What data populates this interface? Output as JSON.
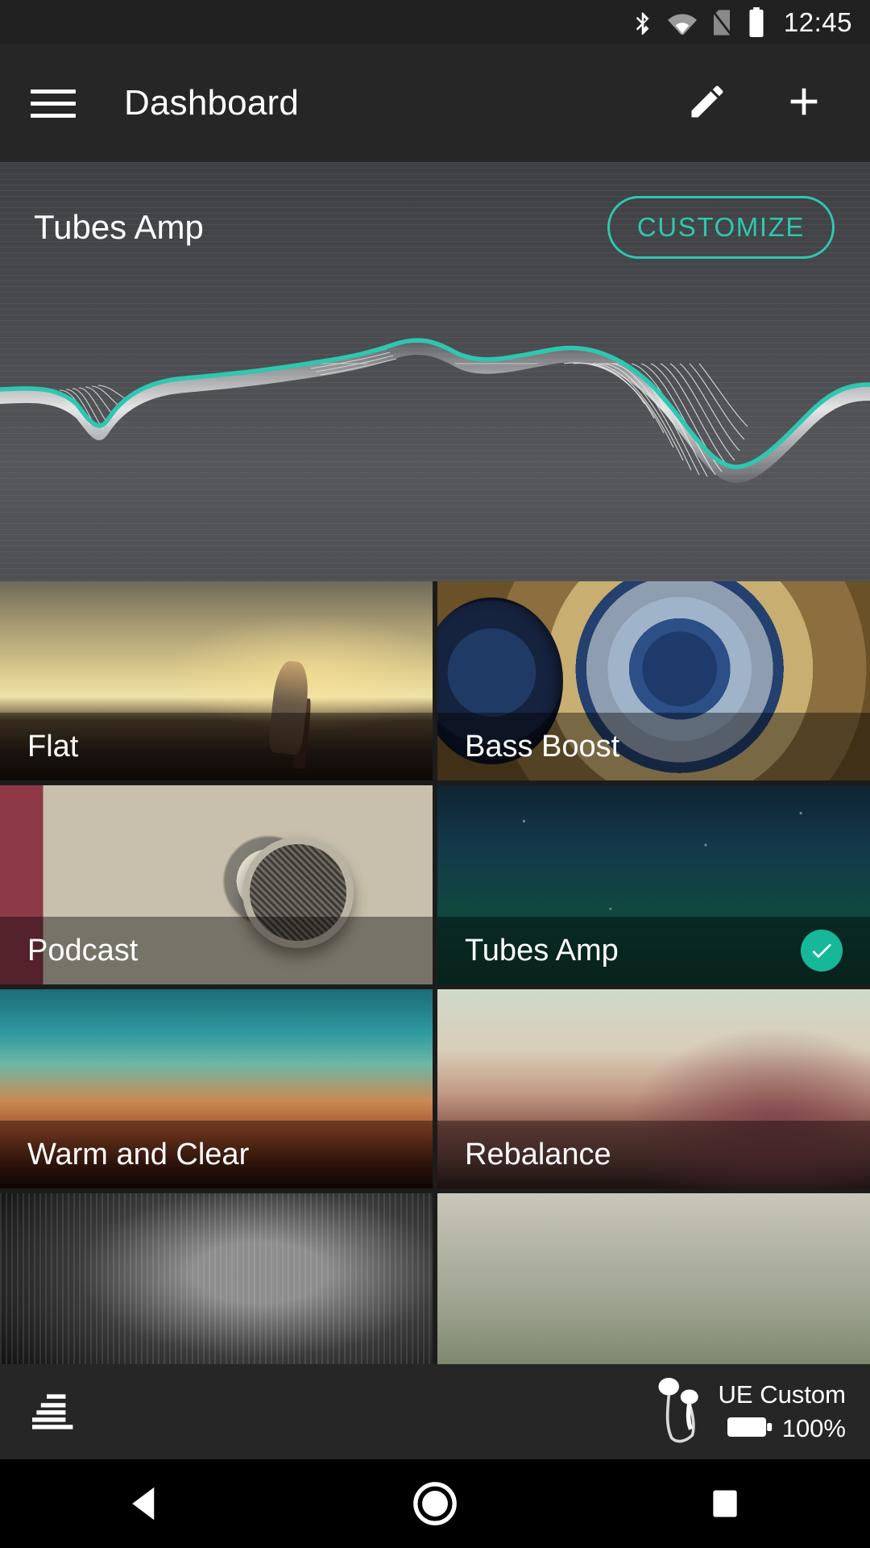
{
  "statusbar": {
    "clock": "12:45",
    "icons": [
      "bluetooth-icon",
      "wifi-icon",
      "sim-card-off-icon",
      "battery-icon"
    ]
  },
  "appbar": {
    "menu_icon": "hamburger-menu-icon",
    "title": "Dashboard",
    "edit_icon": "pencil-edit-icon",
    "add_icon": "plus-add-icon"
  },
  "hero": {
    "preset_name": "Tubes Amp",
    "customize_label": "CUSTOMIZE",
    "accent_color": "#2ec7b0"
  },
  "presets": [
    {
      "label": "Flat",
      "art": "art-runner",
      "selected": false
    },
    {
      "label": "Bass Boost",
      "art": "art-speaker",
      "selected": false
    },
    {
      "label": "Podcast",
      "art": "art-podcast",
      "selected": false
    },
    {
      "label": "Tubes Amp",
      "art": "art-space",
      "selected": true
    },
    {
      "label": "Warm and Clear",
      "art": "art-warm",
      "selected": false
    },
    {
      "label": "Rebalance",
      "art": "art-rebalance",
      "selected": false
    },
    {
      "label": "",
      "art": "art-dark-grill",
      "selected": false
    },
    {
      "label": "",
      "art": "art-pale",
      "selected": false
    }
  ],
  "bottombar": {
    "eq_icon": "equalizer-icon",
    "device_icon": "earbuds-icon",
    "device_name": "UE Custom",
    "battery_icon": "battery-full-icon",
    "battery_percent": "100%"
  },
  "navbar": {
    "back": "back-triangle-icon",
    "home": "home-circle-icon",
    "recents": "recents-square-icon"
  },
  "check_badge_color": "#17b79a"
}
